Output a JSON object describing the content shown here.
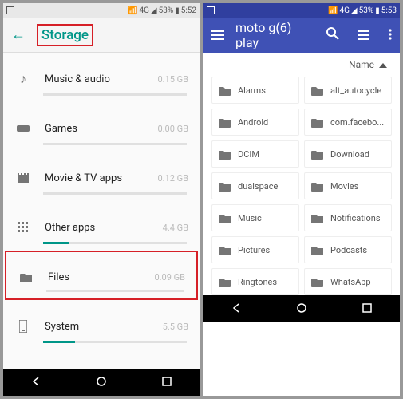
{
  "left": {
    "statusbar": {
      "signal": "4G",
      "battery": "53%",
      "time": "5:52"
    },
    "header": {
      "title": "Storage"
    },
    "rows": [
      {
        "label": "Music & audio",
        "size": "0.15 GB",
        "fill": 0
      },
      {
        "label": "Games",
        "size": "0.00 GB",
        "fill": 0
      },
      {
        "label": "Movie & TV apps",
        "size": "0.12 GB",
        "fill": 0
      },
      {
        "label": "Other apps",
        "size": "4.4 GB",
        "fill": 18
      },
      {
        "label": "Files",
        "size": "0.09 GB",
        "fill": 0
      },
      {
        "label": "System",
        "size": "5.5 GB",
        "fill": 22
      }
    ]
  },
  "right": {
    "statusbar": {
      "signal": "4G",
      "battery": "53%",
      "time": "5:53"
    },
    "header": {
      "title": "moto g(6) play"
    },
    "sort": {
      "label": "Name"
    },
    "folders": [
      "Alarms",
      "alt_autocycle",
      "Android",
      "com.facebo...",
      "DCIM",
      "Download",
      "dualspace",
      "Movies",
      "Music",
      "Notifications",
      "Pictures",
      "Podcasts",
      "Ringtones",
      "WhatsApp"
    ]
  }
}
